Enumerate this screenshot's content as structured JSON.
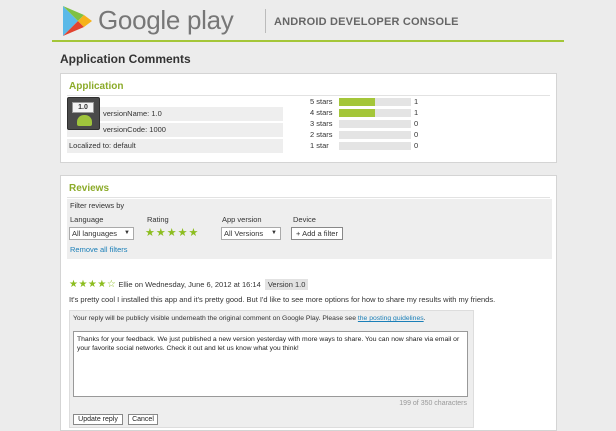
{
  "header": {
    "brand": "Google play",
    "console_title": "ANDROID DEVELOPER CONSOLE"
  },
  "page": {
    "title": "Application Comments"
  },
  "application": {
    "section_title": "Application",
    "icon_badge": "1.0",
    "version_name": "versionName: 1.0",
    "version_code": "versionCode: 1000",
    "localized": "Localized to: default",
    "ratings": [
      {
        "label": "5 stars",
        "count": "1",
        "fraction": 0.5
      },
      {
        "label": "4 stars",
        "count": "1",
        "fraction": 0.5
      },
      {
        "label": "3 stars",
        "count": "0",
        "fraction": 0
      },
      {
        "label": "2 stars",
        "count": "0",
        "fraction": 0
      },
      {
        "label": "1 star",
        "count": "0",
        "fraction": 0
      }
    ]
  },
  "reviews": {
    "section_title": "Reviews",
    "filter_title": "Filter reviews by",
    "language_label": "Language",
    "language_value": "All languages",
    "rating_label": "Rating",
    "rating_stars": "★★★★★",
    "app_version_label": "App version",
    "app_version_value": "All Versions",
    "device_label": "Device",
    "add_filter": "+ Add a filter",
    "remove_filters": "Remove all filters",
    "review": {
      "stars": "★★★★☆",
      "author_line": "Ellie on Wednesday, June 6, 2012 at 16:14",
      "version": "Version 1.0",
      "text": "It's pretty cool I installed this app and it's pretty good. But I'd like to see more options for how to share my results with my friends."
    },
    "reply": {
      "note": "Your reply will be publicly visible underneath the original comment on Google Play. Please see",
      "guidelines_link": "the posting guidelines",
      "note_end": ".",
      "text": "Thanks for your feedback. We just published a new version yesterday with more ways to share. You can now share via email or your favorite social networks. Check it out and let us know what you think!",
      "char_count": "199 of 350 characters",
      "update_button": "Update reply",
      "cancel_button": "Cancel"
    }
  },
  "colors": {
    "accent": "#a4c639",
    "link": "#1a7fb8",
    "section_title": "#8cab2a"
  }
}
